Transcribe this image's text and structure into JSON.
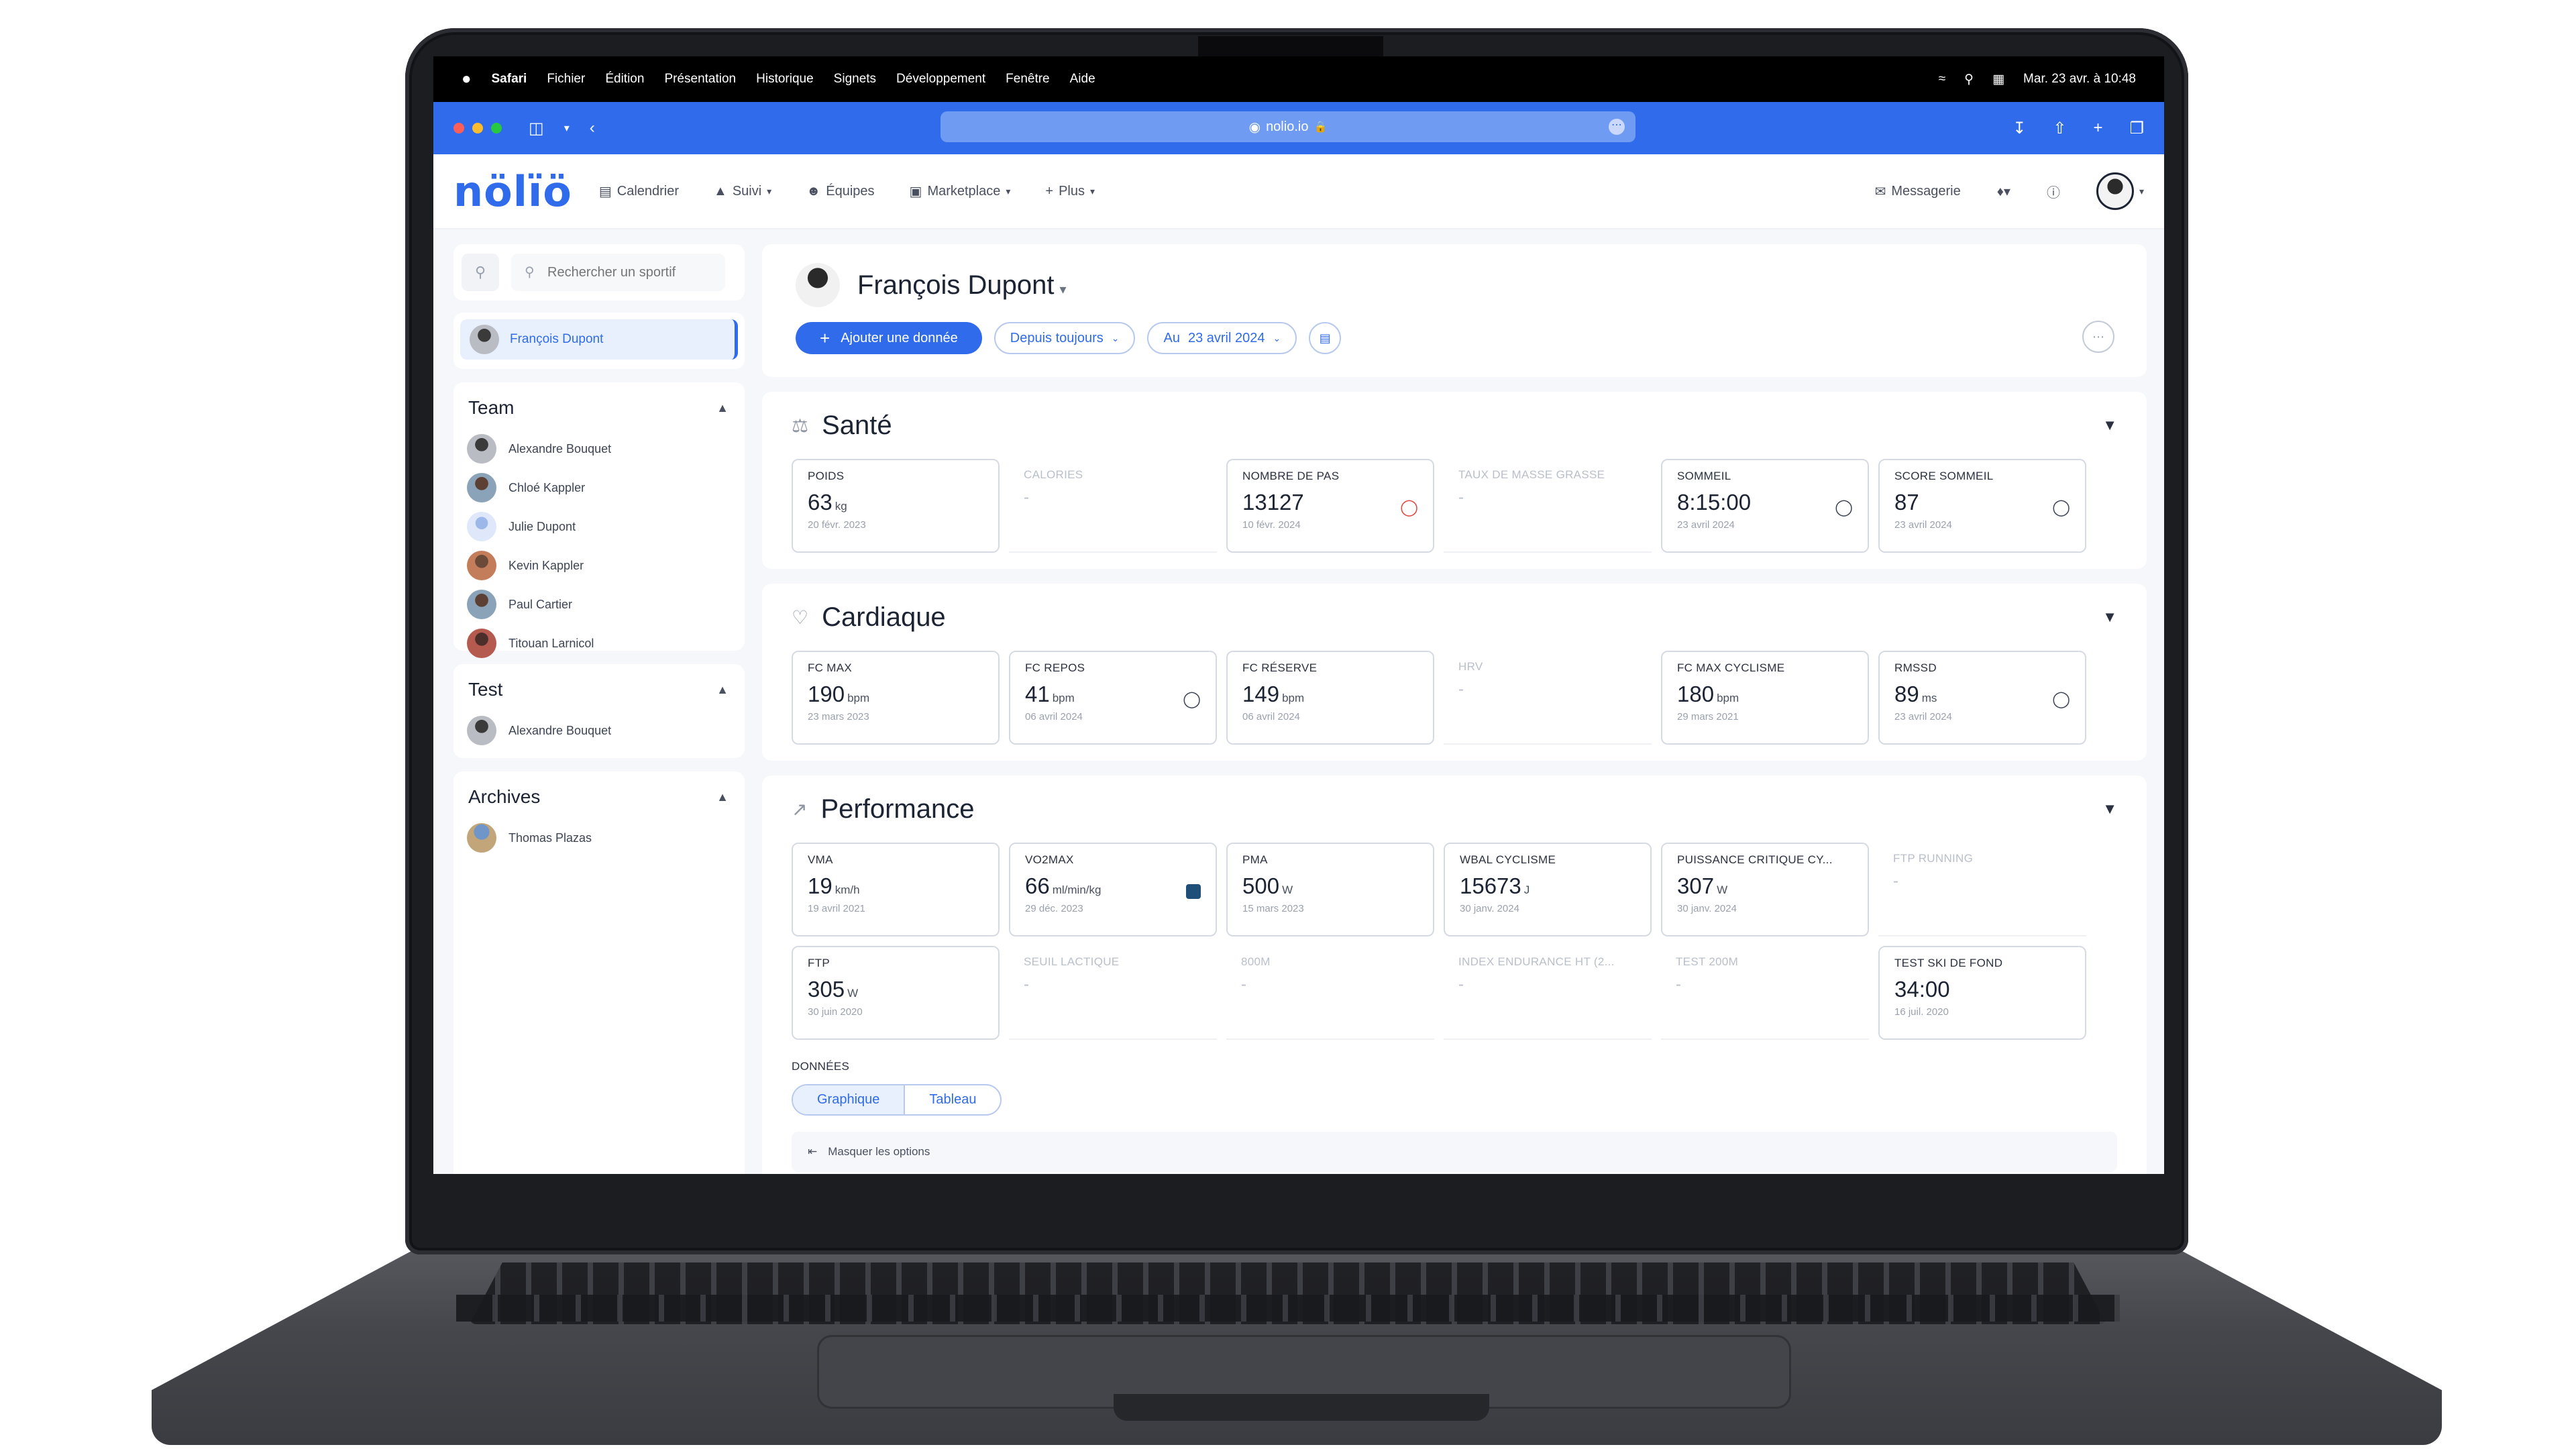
{
  "menubar": {
    "apple": "",
    "items": [
      "Safari",
      "Fichier",
      "Édition",
      "Présentation",
      "Historique",
      "Signets",
      "Développement",
      "Fenêtre",
      "Aide"
    ],
    "clock": "Mar. 23 avr. à 10:48"
  },
  "browser": {
    "url": "nolio.io"
  },
  "nav": {
    "logo": "nölïö",
    "items": [
      "Calendrier",
      "Suivi",
      "Équipes",
      "Marketplace",
      "Plus"
    ],
    "messages": "Messagerie"
  },
  "sidebar": {
    "search_placeholder": "Rechercher un sportif",
    "selected": "François Dupont",
    "groups": [
      {
        "title": "Team",
        "members": [
          "Alexandre Bouquet",
          "Chloé Kappler",
          "Julie Dupont",
          "Kevin Kappler",
          "Paul Cartier",
          "Titouan Larnicol"
        ]
      },
      {
        "title": "Test",
        "members": [
          "Alexandre Bouquet"
        ]
      },
      {
        "title": "Archives",
        "members": [
          "Thomas Plazas"
        ]
      }
    ]
  },
  "profile": {
    "name": "François Dupont",
    "add_button": "Ajouter une donnée",
    "since_filter": "Depuis toujours",
    "until_prefix": "Au",
    "until_date": "23 avril 2024"
  },
  "sections": {
    "sante": {
      "title": "Santé",
      "tiles": [
        {
          "label": "POIDS",
          "value": "63",
          "unit": "kg",
          "date": "20 févr. 2023"
        },
        {
          "label": "CALORIES",
          "value": "-",
          "unit": "",
          "date": ""
        },
        {
          "label": "NOMBRE DE PAS",
          "value": "13127",
          "unit": "",
          "date": "10 févr. 2024"
        },
        {
          "label": "TAUX DE MASSE GRASSE",
          "value": "-",
          "unit": "",
          "date": ""
        },
        {
          "label": "SOMMEIL",
          "value": "8:15:00",
          "unit": "",
          "date": "23 avril 2024"
        },
        {
          "label": "SCORE SOMMEIL",
          "value": "87",
          "unit": "",
          "date": "23 avril 2024"
        }
      ]
    },
    "cardiaque": {
      "title": "Cardiaque",
      "tiles": [
        {
          "label": "FC MAX",
          "value": "190",
          "unit": "bpm",
          "date": "23 mars 2023"
        },
        {
          "label": "FC REPOS",
          "value": "41",
          "unit": "bpm",
          "date": "06 avril 2024"
        },
        {
          "label": "FC RÉSERVE",
          "value": "149",
          "unit": "bpm",
          "date": "06 avril 2024"
        },
        {
          "label": "HRV",
          "value": "-",
          "unit": "",
          "date": ""
        },
        {
          "label": "FC MAX CYCLISME",
          "value": "180",
          "unit": "bpm",
          "date": "29 mars 2021"
        },
        {
          "label": "RMSSD",
          "value": "89",
          "unit": "ms",
          "date": "23 avril 2024"
        }
      ]
    },
    "performance": {
      "title": "Performance",
      "tiles": [
        {
          "label": "VMA",
          "value": "19",
          "unit": "km/h",
          "date": "19 avril 2021"
        },
        {
          "label": "VO2MAX",
          "value": "66",
          "unit": "ml/min/kg",
          "date": "29 déc. 2023"
        },
        {
          "label": "PMA",
          "value": "500",
          "unit": "W",
          "date": "15 mars 2023"
        },
        {
          "label": "WBAL CYCLISME",
          "value": "15673",
          "unit": "J",
          "date": "30 janv. 2024"
        },
        {
          "label": "PUISSANCE CRITIQUE CY...",
          "value": "307",
          "unit": "W",
          "date": "30 janv. 2024"
        },
        {
          "label": "FTP RUNNING",
          "value": "-",
          "unit": "",
          "date": ""
        },
        {
          "label": "FTP",
          "value": "305",
          "unit": "W",
          "date": "30 juin 2020"
        },
        {
          "label": "SEUIL LACTIQUE",
          "value": "-",
          "unit": "",
          "date": ""
        },
        {
          "label": "800M",
          "value": "-",
          "unit": "",
          "date": ""
        },
        {
          "label": "INDEX ENDURANCE HT (2...",
          "value": "-",
          "unit": "",
          "date": ""
        },
        {
          "label": "TEST 200M",
          "value": "-",
          "unit": "",
          "date": ""
        },
        {
          "label": "TEST SKI DE FOND",
          "value": "34:00",
          "unit": "",
          "date": "16 juil. 2020"
        }
      ]
    }
  },
  "data_block": {
    "label": "DONNÉES",
    "tab_chart": "Graphique",
    "tab_table": "Tableau",
    "hide_options": "Masquer les options"
  }
}
